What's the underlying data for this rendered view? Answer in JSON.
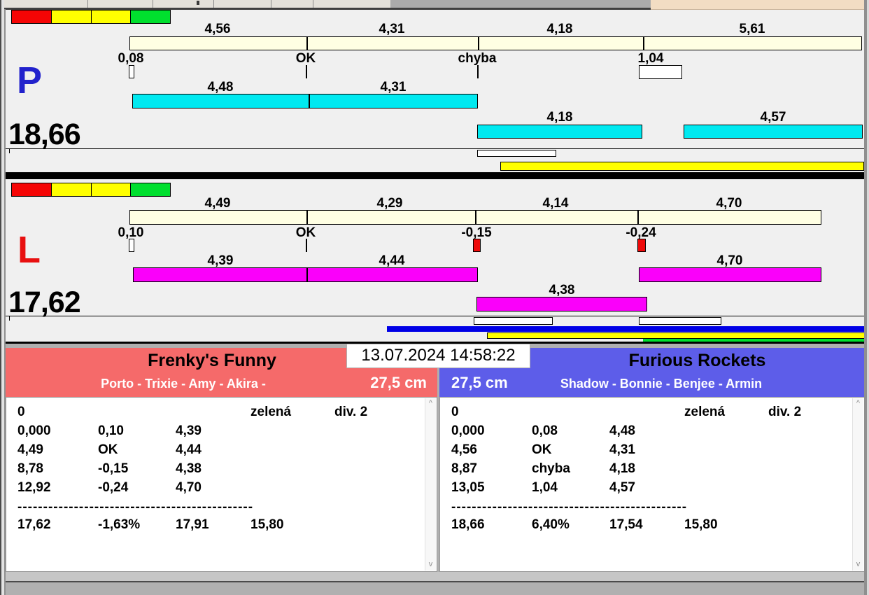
{
  "top": {
    "datetime": "13.07.2024 14:58:22"
  },
  "p": {
    "letter": "P",
    "total": "18,66",
    "splits": [
      "4,56",
      "4,31",
      "4,18",
      "5,61"
    ],
    "marks": [
      "0,08",
      "OK",
      "chyba",
      "1,04"
    ],
    "row1": [
      "4,48",
      "4,31"
    ],
    "row2": [
      "4,18",
      "4,57"
    ]
  },
  "l": {
    "letter": "L",
    "total": "17,62",
    "splits": [
      "4,49",
      "4,29",
      "4,14",
      "4,70"
    ],
    "marks": [
      "0,10",
      "OK",
      "-0,15",
      "-0,24"
    ],
    "row1": [
      "4,39",
      "4,44"
    ],
    "row1b": [
      "4,70"
    ],
    "row2": [
      "4,38"
    ]
  },
  "left_team": {
    "name": "Frenky's Funny",
    "dogs": "Porto - Trixie - Amy - Akira -",
    "size": "27,5 cm",
    "run": "0",
    "color_label": "zelená",
    "division": "div. 2",
    "rows": [
      [
        "0,000",
        "0,10",
        "4,39"
      ],
      [
        "4,49",
        "OK",
        "4,44"
      ],
      [
        "8,78",
        "-0,15",
        "4,38"
      ],
      [
        "12,92",
        "-0,24",
        "4,70"
      ]
    ],
    "separator": "----------------------------------------------",
    "summary": [
      "17,62",
      "-1,63%",
      "17,91",
      "15,80"
    ]
  },
  "right_team": {
    "name": "Furious Rockets",
    "dogs": "Shadow - Bonnie - Benjee - Armin",
    "size": "27,5 cm",
    "run": "0",
    "color_label": "zelená",
    "division": "div. 2",
    "rows": [
      [
        "0,000",
        "0,08",
        "4,48"
      ],
      [
        "4,56",
        "OK",
        "4,31"
      ],
      [
        "8,87",
        "chyba",
        "4,18"
      ],
      [
        "13,05",
        "1,04",
        "4,57"
      ]
    ],
    "separator": "----------------------------------------------",
    "summary": [
      "18,66",
      "6,40%",
      "17,54",
      "15,80"
    ]
  },
  "colors": {
    "cyan": "#00e9f0",
    "magenta": "#fa00fa",
    "cream": "#ffffe3",
    "left_header": "#f56a6a",
    "right_header": "#5d5de9",
    "blue_bar": "#0000e6",
    "green_bar": "#00df2e"
  }
}
